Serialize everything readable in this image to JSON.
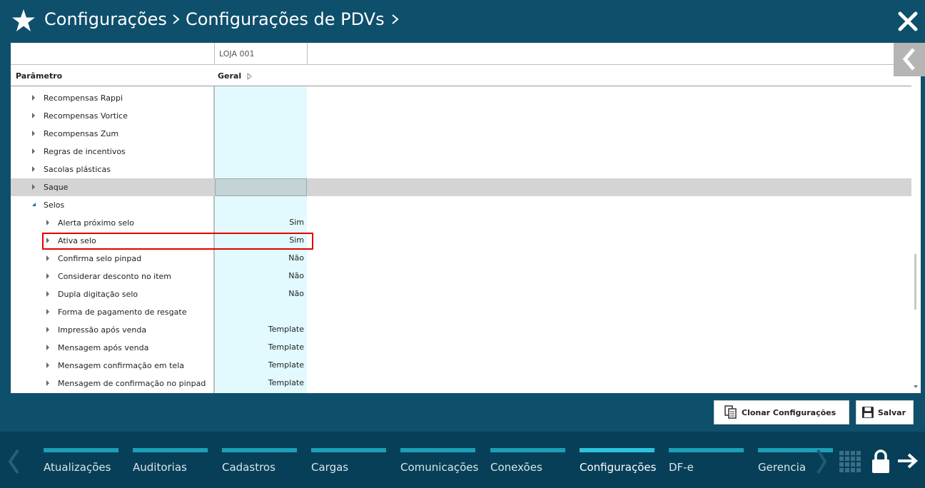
{
  "header": {
    "breadcrumb": [
      "Configurações",
      "Configurações de PDVs"
    ]
  },
  "grid": {
    "store_column": "LOJA 001",
    "param_header": "Parâmetro",
    "geral_header": "Geral",
    "rows": [
      {
        "label": "Recompensas Rappi",
        "value": "",
        "level": 1,
        "expanded": false
      },
      {
        "label": "Recompensas Vortice",
        "value": "",
        "level": 1,
        "expanded": false
      },
      {
        "label": "Recompensas Zum",
        "value": "",
        "level": 1,
        "expanded": false
      },
      {
        "label": "Regras de incentivos",
        "value": "",
        "level": 1,
        "expanded": false
      },
      {
        "label": "Sacolas plásticas",
        "value": "",
        "level": 1,
        "expanded": false
      },
      {
        "label": "Saque",
        "value": "",
        "level": 1,
        "expanded": false,
        "selected": true
      },
      {
        "label": "Selos",
        "value": "",
        "level": 1,
        "expanded": true
      },
      {
        "label": "Alerta próximo selo",
        "value": "Sim",
        "level": 2,
        "expanded": false
      },
      {
        "label": "Ativa selo",
        "value": "Sim",
        "level": 2,
        "expanded": false,
        "highlighted": true
      },
      {
        "label": "Confirma selo pinpad",
        "value": "Não",
        "level": 2,
        "expanded": false
      },
      {
        "label": "Considerar desconto no item",
        "value": "Não",
        "level": 2,
        "expanded": false
      },
      {
        "label": "Dupla digitação selo",
        "value": "Não",
        "level": 2,
        "expanded": false
      },
      {
        "label": "Forma de pagamento de resgate",
        "value": "",
        "level": 2,
        "expanded": false
      },
      {
        "label": "Impressão após venda",
        "value": "Template",
        "level": 2,
        "expanded": false
      },
      {
        "label": "Mensagem após venda",
        "value": "Template",
        "level": 2,
        "expanded": false
      },
      {
        "label": "Mensagem confirmação em tela",
        "value": "Template",
        "level": 2,
        "expanded": false
      },
      {
        "label": "Mensagem de confirmação no pinpad",
        "value": "Template",
        "level": 2,
        "expanded": false
      }
    ]
  },
  "actions": {
    "clone_label": "Clonar Configurações",
    "save_label": "Salvar"
  },
  "bottom_nav": {
    "items": [
      "Atualizações",
      "Auditorias",
      "Cadastros",
      "Cargas",
      "Comunicações",
      "Conexões",
      "Configurações",
      "DF-e",
      "Gerencia"
    ],
    "active": "Configurações"
  },
  "colors": {
    "header_bg": "#0e4f6c",
    "nav_bg": "#083f58",
    "nav_bar": "#1aa0b8",
    "geral_column": "#e2fafd",
    "highlight_border": "#e00000"
  }
}
